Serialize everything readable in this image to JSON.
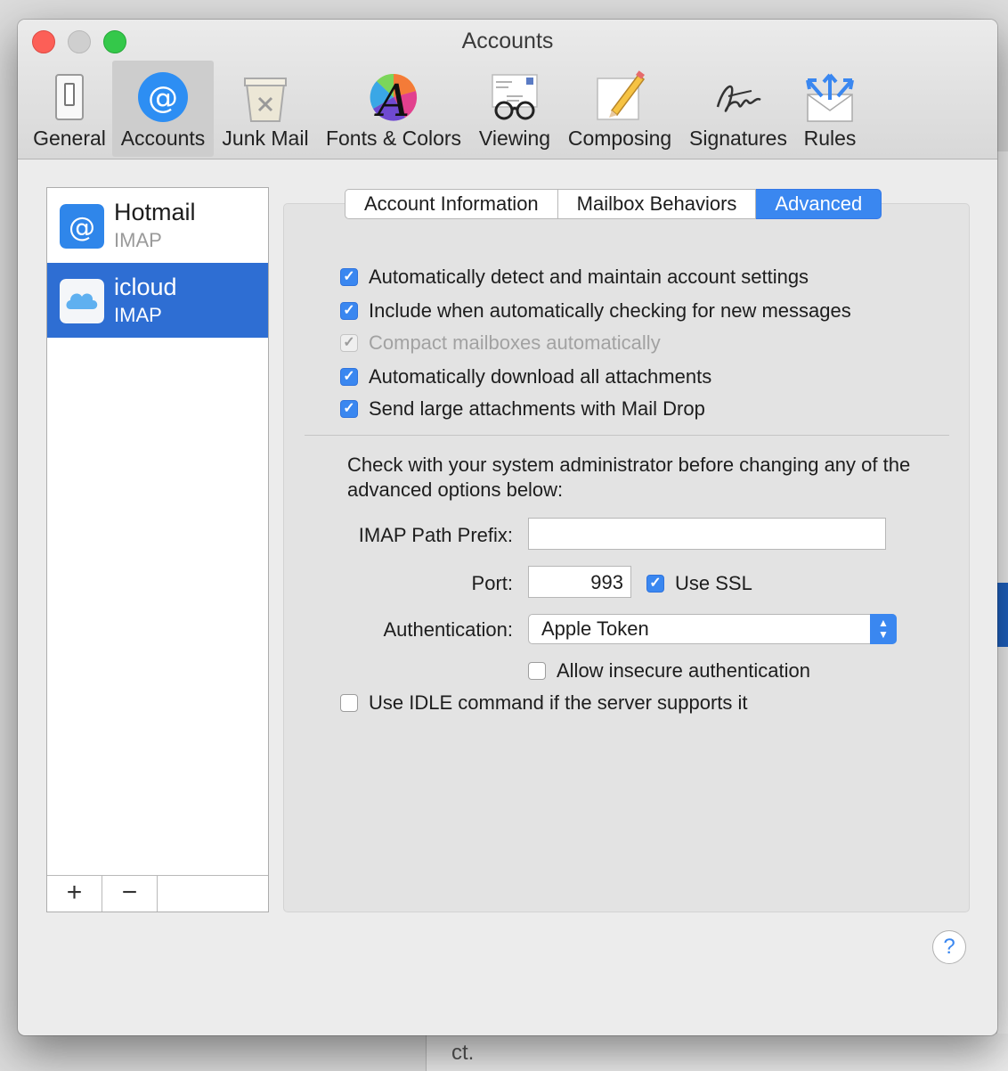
{
  "window": {
    "title": "Accounts"
  },
  "toolbar": {
    "items": [
      {
        "label": "General"
      },
      {
        "label": "Accounts"
      },
      {
        "label": "Junk Mail"
      },
      {
        "label": "Fonts & Colors"
      },
      {
        "label": "Viewing"
      },
      {
        "label": "Composing"
      },
      {
        "label": "Signatures"
      },
      {
        "label": "Rules"
      }
    ],
    "selected": "Accounts"
  },
  "accounts": [
    {
      "name": "Hotmail",
      "type": "IMAP",
      "selected": false
    },
    {
      "name": "icloud",
      "type": "IMAP",
      "selected": true
    }
  ],
  "list_footer": {
    "add": "+",
    "remove": "−"
  },
  "tabs": [
    {
      "label": "Account Information",
      "active": false
    },
    {
      "label": "Mailbox Behaviors",
      "active": false
    },
    {
      "label": "Advanced",
      "active": true
    }
  ],
  "options": [
    {
      "label": "Automatically detect and maintain account settings",
      "checked": true,
      "enabled": true
    },
    {
      "label": "Include when automatically checking for new messages",
      "checked": true,
      "enabled": true
    },
    {
      "label": "Compact mailboxes automatically",
      "checked": true,
      "enabled": false
    },
    {
      "label": "Automatically download all attachments",
      "checked": true,
      "enabled": true
    },
    {
      "label": "Send large attachments with Mail Drop",
      "checked": true,
      "enabled": true
    }
  ],
  "advanced": {
    "note": "Check with your system administrator before changing any of the advanced options below:",
    "imap_path_label": "IMAP Path Prefix:",
    "imap_path_value": "",
    "port_label": "Port:",
    "port_value": "993",
    "use_ssl_label": "Use SSL",
    "use_ssl_checked": true,
    "auth_label": "Authentication:",
    "auth_value": "Apple Token",
    "allow_insecure_label": "Allow insecure authentication",
    "allow_insecure_checked": false,
    "idle_label": "Use IDLE command if the server supports it",
    "idle_checked": false
  },
  "help": {
    "label": "?"
  },
  "background": {
    "bottom_text": "ct."
  },
  "colors": {
    "accent": "#3a87f0",
    "selection": "#2e6ed3"
  }
}
